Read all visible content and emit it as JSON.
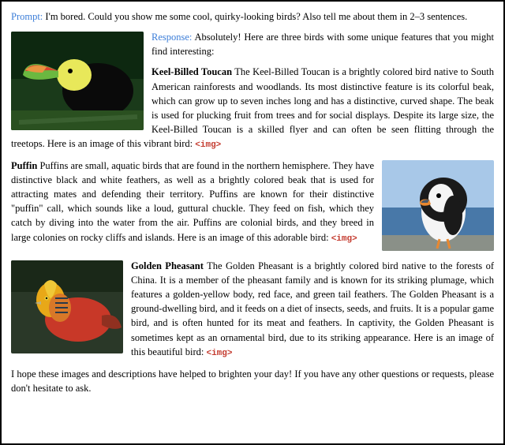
{
  "prompt": {
    "label": "Prompt:",
    "text": "I'm bored. Could you show me some cool, quirky-looking birds? Also tell me about them in 2–3 sentences."
  },
  "response": {
    "label": "Response:",
    "intro": "Absolutely! Here are three birds with some unique features that you might find interesting:",
    "birds": [
      {
        "name": "Keel-Billed Toucan",
        "text": " The Keel-Billed Toucan is a brightly colored bird native to South American rainforests and woodlands. Its most distinctive feature is its colorful beak, which can grow up to seven inches long and has a distinctive, curved shape. The beak is used for plucking fruit from trees and for social displays. Despite its large size, the Keel-Billed Toucan is a skilled flyer and can often be seen flitting through the treetops. Here is an image of this vibrant bird: ",
        "img_tag": "<img>"
      },
      {
        "name": "Puffin",
        "text": " Puffins are small, aquatic birds that are found in the northern hemisphere. They have distinctive black and white feathers, as well as a brightly colored beak that is used for attracting mates and defending their territory. Puffins are known for their distinctive \"puffin\" call, which sounds like a loud, guttural chuckle. They feed on fish, which they catch by diving into the water from the air. Puffins are colonial birds, and they breed in large colonies on rocky cliffs and islands. Here is an image of this adorable bird: ",
        "img_tag": "<img>"
      },
      {
        "name": "Golden Pheasant",
        "text": " The Golden Pheasant is a brightly colored bird native to the forests of China. It is a member of the pheasant family and is known for its striking plumage, which features a golden-yellow body, red face, and green tail feathers. The Golden Pheasant is a ground-dwelling bird, and it feeds on a diet of insects, seeds, and fruits. It is a popular game bird, and is often hunted for its meat and feathers. In captivity, the Golden Pheasant is sometimes kept as an ornamental bird, due to its striking appearance. Here is an image of this beautiful bird: ",
        "img_tag": "<img>"
      }
    ],
    "closing": "I hope these images and descriptions have helped to brighten your day! If you have any other questions or requests, please don't hesitate to ask."
  }
}
